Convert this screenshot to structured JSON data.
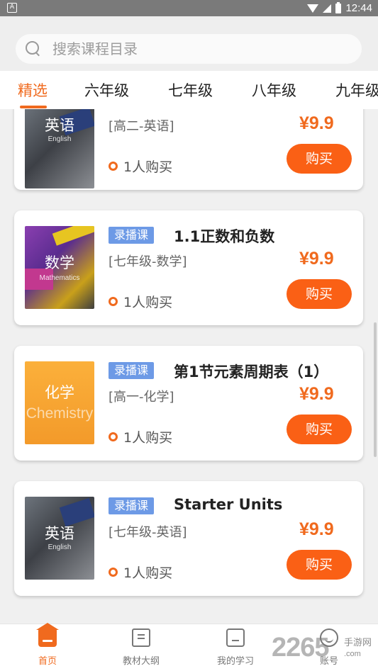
{
  "status_bar": {
    "time": "12:44",
    "notification_icon": "app-notification-icon"
  },
  "search": {
    "placeholder": "搜索课程目录"
  },
  "tabs": [
    {
      "label": "精选",
      "active": true
    },
    {
      "label": "六年级"
    },
    {
      "label": "七年级"
    },
    {
      "label": "八年级"
    },
    {
      "label": "九年级"
    }
  ],
  "courses": [
    {
      "badge": "",
      "title": "",
      "subtitle": "[高二-英语]",
      "price": "¥9.9",
      "buyers": "1人购买",
      "buy_label": "购买",
      "thumb": {
        "title": "英语",
        "sub": "English"
      }
    },
    {
      "badge": "录播课",
      "title": "1.1正数和负数",
      "subtitle": "[七年级-数学]",
      "price": "¥9.9",
      "buyers": "1人购买",
      "buy_label": "购买",
      "thumb": {
        "title": "数学",
        "sub": "Mathematics"
      }
    },
    {
      "badge": "录播课",
      "title": "第1节元素周期表（1）",
      "subtitle": "[高一-化学]",
      "price": "¥9.9",
      "buyers": "1人购买",
      "buy_label": "购买",
      "thumb": {
        "title": "化学",
        "sub": "Chemistry"
      }
    },
    {
      "badge": "录播课",
      "title": "Starter Units",
      "subtitle": "[七年级-英语]",
      "price": "¥9.9",
      "buyers": "1人购买",
      "buy_label": "购买",
      "thumb": {
        "title": "英语",
        "sub": "English"
      }
    }
  ],
  "bottom_nav": [
    {
      "label": "首页",
      "icon": "home-icon",
      "active": true
    },
    {
      "label": "教材大纲",
      "icon": "book-icon"
    },
    {
      "label": "我的学习",
      "icon": "screen-icon"
    },
    {
      "label": "账号",
      "icon": "user-icon"
    }
  ],
  "watermark": {
    "number": "2265",
    "name": "手游网",
    "url": ".com"
  },
  "colors": {
    "accent": "#f06a1e",
    "button": "#fa6015",
    "badge": "#6d9ae6"
  }
}
